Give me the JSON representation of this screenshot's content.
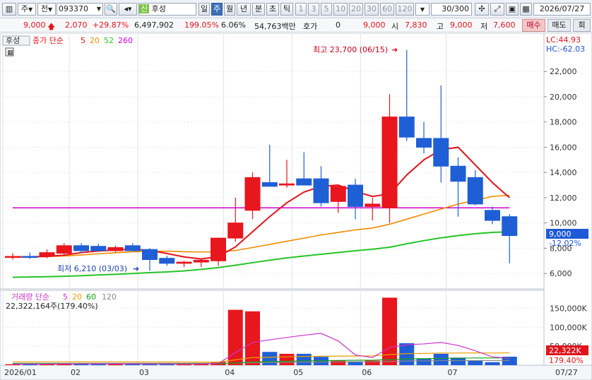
{
  "toolbar": {
    "market": "주",
    "type": "전",
    "code": "093370",
    "name_prefix": "신",
    "name": "후성",
    "periods": [
      "일",
      "주",
      "월",
      "년",
      "분",
      "초",
      "틱"
    ],
    "selected_period": "주",
    "nums": [
      "1",
      "3",
      "5",
      "10",
      "20",
      "30",
      "60",
      "120"
    ],
    "count": "30/300",
    "date": "2026/07/27"
  },
  "info": {
    "price": "9,000",
    "change": "2,070",
    "change_pct": "+29.87%",
    "volume": "6,497,902",
    "vol_ratio": "199.05%",
    "turnover": "6.06%",
    "amount": "54,763백만",
    "hoga_label": "호가",
    "hoga_value": "0",
    "quote": "9,000",
    "open_label": "시",
    "open": "7,830",
    "high_label": "고",
    "high": "9,000",
    "low_label": "저",
    "low": "7,600",
    "buy": "매수",
    "sell": "매도",
    "misc": "회"
  },
  "price_panel": {
    "stock_tag": "후성",
    "ma_label": "종가 단순",
    "ma_periods": [
      {
        "label": "5",
        "color": "#e0141b"
      },
      {
        "label": "20",
        "color": "#f08a00"
      },
      {
        "label": "52",
        "color": "#27c427"
      },
      {
        "label": "260",
        "color": "#d400d4"
      }
    ],
    "lc": "LC:44.93",
    "hc": "HC:-62.03",
    "high_note": "최고 23,700 (06/15)",
    "low_note": "최저 6,210 (03/03)",
    "current_tag": "9,000",
    "current_pct": "-12.02%"
  },
  "volume_panel": {
    "label": "거래량 단순",
    "ma_periods": [
      {
        "label": "5",
        "color": "#cc33cc"
      },
      {
        "label": "20",
        "color": "#e8a000"
      },
      {
        "label": "60",
        "color": "#1aa01a"
      },
      {
        "label": "120",
        "color": "#888888"
      }
    ],
    "summary": "22,322,164주(179.40%)",
    "current_tag": "22,322K",
    "current_pct": "179.40%"
  },
  "x_labels": [
    "2026/01",
    "02",
    "03",
    "04",
    "05",
    "06",
    "07"
  ],
  "x_end_label": "07/27",
  "chart_data": {
    "type": "candlestick",
    "interval": "weekly",
    "y_ticks": [
      6000,
      8000,
      10000,
      12000,
      14000,
      16000,
      18000,
      20000,
      22000
    ],
    "ylim": [
      5000,
      24700
    ],
    "candles": [
      {
        "o": 7300,
        "h": 7600,
        "l": 7100,
        "c": 7350
      },
      {
        "o": 7350,
        "h": 7650,
        "l": 7150,
        "c": 7300
      },
      {
        "o": 7400,
        "h": 7900,
        "l": 7200,
        "c": 7650
      },
      {
        "o": 7600,
        "h": 8400,
        "l": 7500,
        "c": 8200
      },
      {
        "o": 8200,
        "h": 8400,
        "l": 7600,
        "c": 7800
      },
      {
        "o": 8150,
        "h": 8350,
        "l": 7750,
        "c": 7800
      },
      {
        "o": 7800,
        "h": 8200,
        "l": 7700,
        "c": 8050
      },
      {
        "o": 8200,
        "h": 8400,
        "l": 7900,
        "c": 7800
      },
      {
        "o": 7900,
        "h": 8000,
        "l": 6210,
        "c": 7100
      },
      {
        "o": 7200,
        "h": 7400,
        "l": 6600,
        "c": 6800
      },
      {
        "o": 6800,
        "h": 7000,
        "l": 6500,
        "c": 6900
      },
      {
        "o": 6900,
        "h": 7100,
        "l": 6500,
        "c": 7050
      },
      {
        "o": 7000,
        "h": 8000,
        "l": 6600,
        "c": 8800
      },
      {
        "o": 8800,
        "h": 12000,
        "l": 8500,
        "c": 10000
      },
      {
        "o": 11000,
        "h": 14000,
        "l": 10300,
        "c": 13600
      },
      {
        "o": 13200,
        "h": 16200,
        "l": 12900,
        "c": 12900
      },
      {
        "o": 13000,
        "h": 15000,
        "l": 12800,
        "c": 13100
      },
      {
        "o": 13500,
        "h": 15600,
        "l": 13100,
        "c": 13000
      },
      {
        "o": 13500,
        "h": 14500,
        "l": 11300,
        "c": 11600
      },
      {
        "o": 11700,
        "h": 13000,
        "l": 10800,
        "c": 12900
      },
      {
        "o": 13000,
        "h": 13500,
        "l": 10300,
        "c": 11300
      },
      {
        "o": 11300,
        "h": 12000,
        "l": 10200,
        "c": 11500
      },
      {
        "o": 11200,
        "h": 20200,
        "l": 10000,
        "c": 18400
      },
      {
        "o": 18400,
        "h": 23700,
        "l": 16500,
        "c": 16800
      },
      {
        "o": 16700,
        "h": 18000,
        "l": 15500,
        "c": 16000
      },
      {
        "o": 16700,
        "h": 20900,
        "l": 13200,
        "c": 14500
      },
      {
        "o": 14500,
        "h": 15200,
        "l": 10500,
        "c": 13300
      },
      {
        "o": 13600,
        "h": 14200,
        "l": 11400,
        "c": 11500
      },
      {
        "o": 11000,
        "h": 11300,
        "l": 9900,
        "c": 10200
      },
      {
        "o": 10500,
        "h": 10700,
        "l": 6800,
        "c": 9000
      }
    ],
    "ma5": [
      7300,
      7320,
      7350,
      7450,
      7650,
      7780,
      7860,
      7920,
      7830,
      7580,
      7310,
      7150,
      7340,
      8100,
      9300,
      10500,
      11600,
      12450,
      12900,
      13000,
      12500,
      12100,
      12300,
      13800,
      15000,
      15800,
      16000,
      14600,
      13200,
      12000
    ],
    "ma20": [
      7300,
      7310,
      7330,
      7380,
      7460,
      7560,
      7640,
      7720,
      7760,
      7760,
      7720,
      7700,
      7720,
      7820,
      8050,
      8300,
      8550,
      8800,
      9050,
      9250,
      9450,
      9600,
      9900,
      10300,
      10700,
      11100,
      11500,
      11800,
      12100,
      12200
    ],
    "ma52": [
      5700,
      5720,
      5740,
      5780,
      5820,
      5880,
      5930,
      5990,
      6060,
      6120,
      6200,
      6320,
      6460,
      6650,
      6850,
      7050,
      7230,
      7380,
      7520,
      7660,
      7800,
      7920,
      8080,
      8350,
      8600,
      8820,
      9000,
      9150,
      9250,
      9300
    ],
    "ma260": [
      11200,
      11200,
      11200,
      11200,
      11200,
      11200,
      11200,
      11200,
      11200,
      11200,
      11200,
      11200,
      11200,
      11200,
      11200,
      11200,
      11200,
      11200,
      11200,
      11200,
      11200,
      11200,
      11200,
      11200,
      11200,
      11200,
      11200,
      11200,
      11200,
      11200
    ],
    "volume": {
      "y_ticks": [
        50000,
        100000,
        150000
      ],
      "ylim": [
        0,
        190000
      ],
      "values": [
        2500,
        2800,
        3000,
        5000,
        3500,
        3000,
        2800,
        3200,
        4000,
        3000,
        2500,
        2800,
        9000,
        146000,
        142000,
        35000,
        30000,
        30000,
        22000,
        12000,
        10000,
        12000,
        178000,
        58000,
        18000,
        30000,
        20000,
        12000,
        8000,
        22322
      ],
      "ma5": [
        2800,
        2800,
        2900,
        3200,
        3400,
        3500,
        3500,
        3500,
        3300,
        3200,
        3100,
        3100,
        4200,
        33000,
        60000,
        67000,
        73000,
        79000,
        84000,
        64000,
        27000,
        20000,
        47000,
        54000,
        56000,
        60000,
        52000,
        38000,
        22000,
        18000
      ],
      "ma20": [
        9000,
        9000,
        9000,
        9000,
        8900,
        8800,
        8700,
        8600,
        8500,
        8400,
        8300,
        8200,
        8200,
        14000,
        20000,
        21000,
        22000,
        23000,
        23500,
        24000,
        24000,
        24500,
        28000,
        30500,
        31000,
        32000,
        32000,
        32500,
        32000,
        32500
      ],
      "ma60": [
        4000,
        4000,
        4000,
        4000,
        4000,
        4000,
        4000,
        4000,
        4000,
        4000,
        4000,
        4000,
        4000,
        6000,
        8500,
        9500,
        10500,
        11500,
        12000,
        12500,
        13000,
        13200,
        15000,
        16500,
        17000,
        18000,
        18500,
        19000,
        19000,
        19200
      ],
      "ma120": [
        5000,
        5000,
        5000,
        5000,
        5000,
        5000,
        5000,
        5000,
        5000,
        5000,
        5000,
        5000,
        5000,
        5500,
        6500,
        7000,
        7500,
        8000,
        8200,
        8500,
        8700,
        8800,
        10000,
        11000,
        11300,
        11800,
        12000,
        12200,
        12200,
        12300
      ]
    }
  }
}
